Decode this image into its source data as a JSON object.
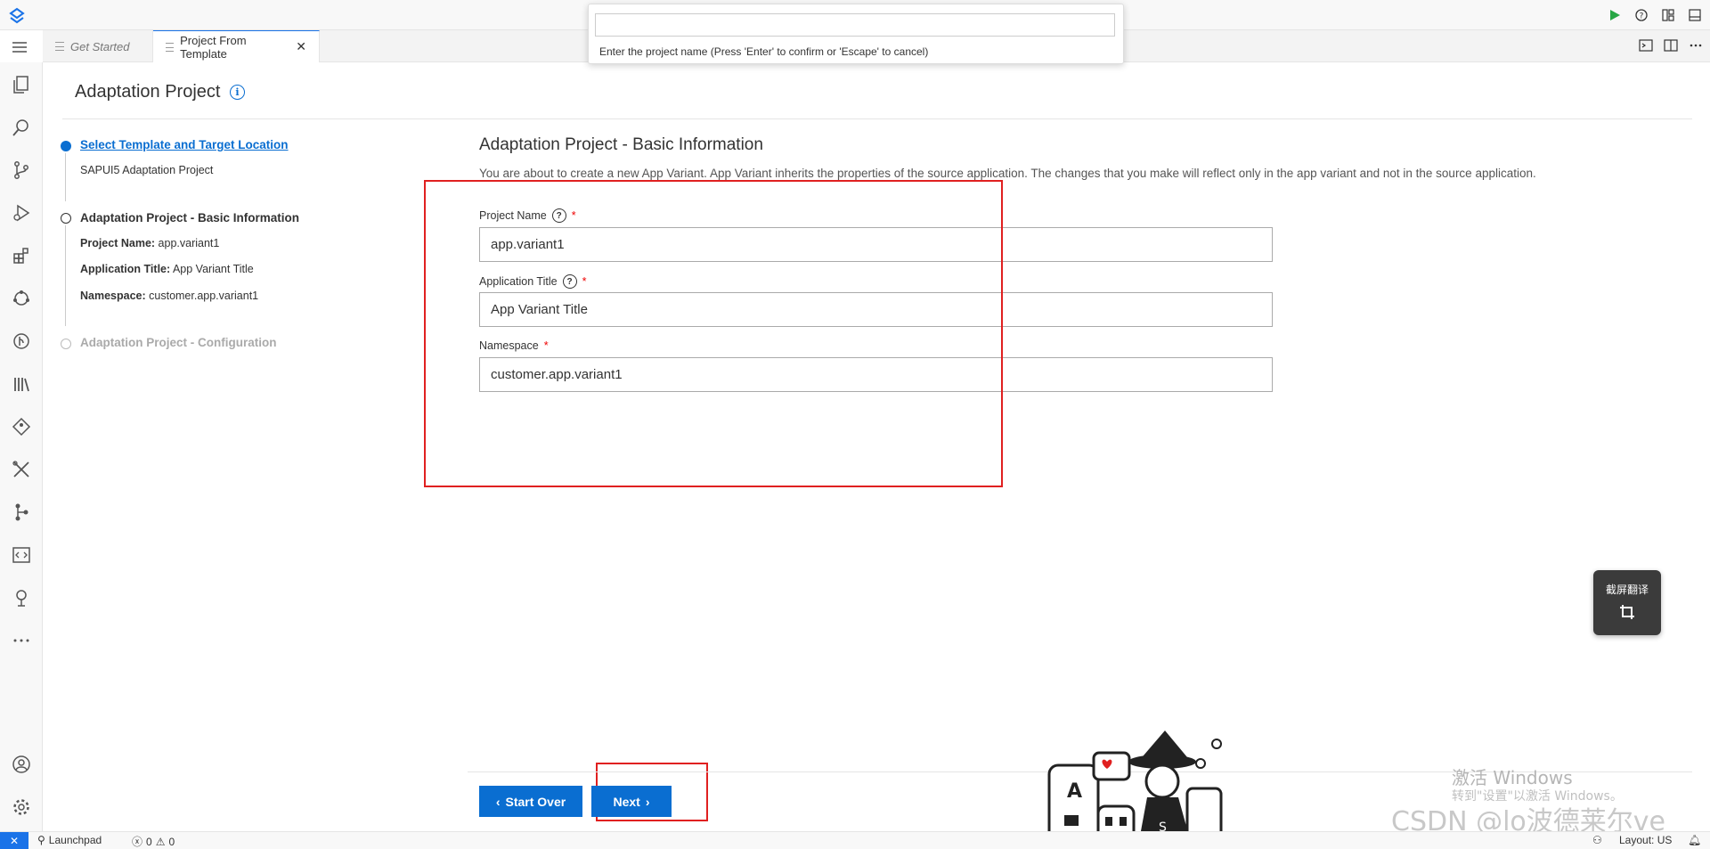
{
  "tabs": [
    {
      "label": "Get Started",
      "active": false
    },
    {
      "label": "Project From Template",
      "active": true
    }
  ],
  "command": {
    "value": "",
    "hint": "Enter the project name (Press 'Enter' to confirm or 'Escape' to cancel)"
  },
  "page": {
    "title": "Adaptation Project"
  },
  "steps": [
    {
      "title": "Select Template and Target Location",
      "state": "done",
      "sub": "SAPUI5 Adaptation Project"
    },
    {
      "title": "Adaptation Project - Basic Information",
      "state": "current",
      "details": [
        {
          "label": "Project Name:",
          "value": "app.variant1"
        },
        {
          "label": "Application Title:",
          "value": "App Variant Title"
        },
        {
          "label": "Namespace:",
          "value": "customer.app.variant1"
        }
      ]
    },
    {
      "title": "Adaptation Project - Configuration",
      "state": "future"
    }
  ],
  "form": {
    "title": "Adaptation Project - Basic Information",
    "description": "You are about to create a new App Variant. App Variant inherits the properties of the source application. The changes that you make will reflect only in the app variant and not in the source application.",
    "fields": [
      {
        "label": "Project Name",
        "value": "app.variant1",
        "required": "*"
      },
      {
        "label": "Application Title",
        "value": "App Variant Title",
        "required": "*"
      },
      {
        "label": "Namespace",
        "value": "customer.app.variant1",
        "required": "*"
      }
    ]
  },
  "buttons": {
    "start_over": "Start Over",
    "next": "Next"
  },
  "float_widget": {
    "label": "截屏翻译"
  },
  "watermark": {
    "activate": "激活 Windows",
    "activate_sub": "转到\"设置\"以激活 Windows。",
    "csdn": "CSDN @lo波德莱尔ve"
  },
  "statusbar": {
    "launchpad": "Launchpad",
    "errors": "0",
    "warnings": "0",
    "layout": "Layout: US"
  },
  "colors": {
    "accent": "#0a6ed1",
    "annotation": "#e02020"
  }
}
